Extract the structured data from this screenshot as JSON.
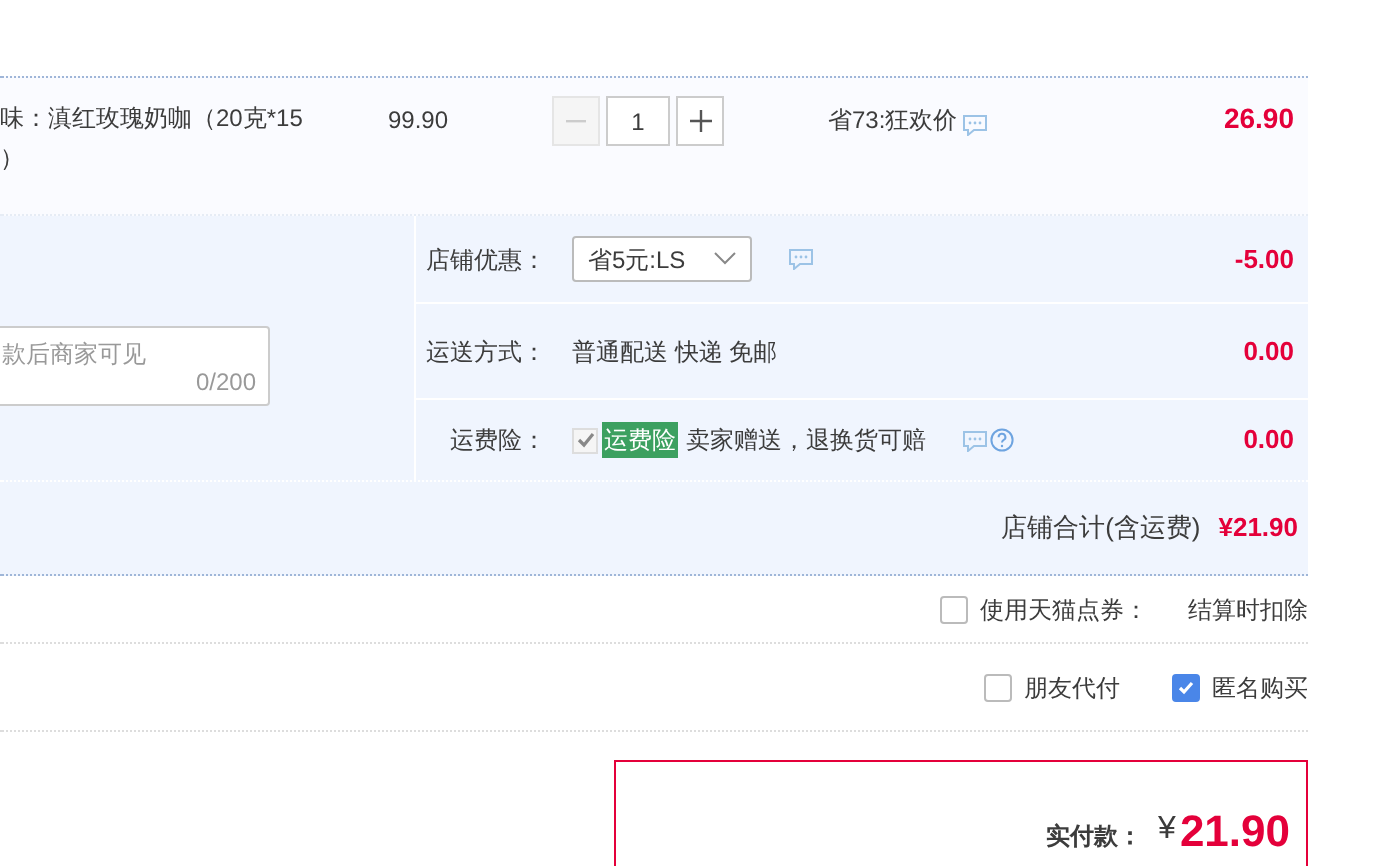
{
  "item": {
    "description": [
      "味：滇红玫瑰奶咖（20克*15",
      "）"
    ],
    "unit_price": "99.90",
    "quantity": "1",
    "promo": "省73:狂欢价",
    "subtotal": "26.90"
  },
  "message": {
    "placeholder": "款后商家可见",
    "counter": "0/200"
  },
  "options": [
    {
      "kind": "select",
      "label": "店铺优惠：",
      "value": "省5元:LS",
      "amount": "-5.00"
    },
    {
      "kind": "text",
      "label": "运送方式：",
      "value": "普通配送 快递 免邮",
      "amount": "0.00"
    },
    {
      "kind": "insurance",
      "label": "运费险：",
      "checked": true,
      "tag": "运费险",
      "value": "卖家赠送，退换货可赔",
      "amount": "0.00"
    }
  ],
  "shop_total": {
    "label": "店铺合计(含运费)",
    "amount": "¥21.90"
  },
  "points": {
    "label": "使用天猫点券：",
    "checked": false,
    "note": "结算时扣除"
  },
  "extras": [
    {
      "label": "朋友代付",
      "checked": false
    },
    {
      "label": "匿名购买",
      "checked": true
    }
  ],
  "payment": {
    "label": "实付款：",
    "currency": "¥",
    "amount": "21.90"
  }
}
